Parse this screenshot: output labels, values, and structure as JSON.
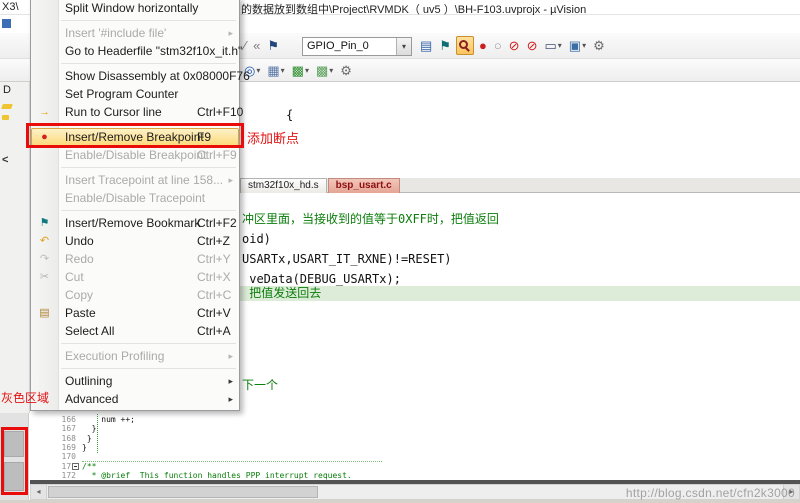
{
  "window": {
    "title_fragment_left": "X3\\",
    "title": "的数据放到数组中\\Project\\RVMDK（ uv5 ）\\BH-F103.uvprojx - µVision"
  },
  "left_pane": {
    "d": "D",
    "chevron": "<"
  },
  "toolbar": {
    "combo_value": "GPIO_Pin_0",
    "row1_pre": [
      {
        "name": "toolbar-fragment-icon-1",
        "glyph": "⁄",
        "color": "#7d7d7d"
      },
      {
        "name": "toolbar-fragment-icon-2",
        "glyph": "«",
        "color": "#7d7d7d"
      },
      {
        "name": "flag-icon",
        "glyph": "⚑",
        "color": "#23467c"
      }
    ],
    "row1_post": [
      {
        "name": "notebook-icon",
        "glyph": "▤",
        "color": "#3465a8"
      },
      {
        "name": "bookmark-flag-icon",
        "glyph": "⚑",
        "color": "#0f6d74"
      },
      {
        "name": "magnifier-breakpoint-icon",
        "glyph": "css-magnifier",
        "color": "#8b2020",
        "boxed": true
      },
      {
        "name": "insert-remove-breakpoint-icon",
        "glyph": "●",
        "color": "#cf1d1d"
      },
      {
        "name": "disable-all-breakpoints-icon",
        "glyph": "○",
        "color": "#9a9a9a"
      },
      {
        "name": "kill-all-breakpoints-icon",
        "glyph": "⊘",
        "color": "#cf1d1d"
      },
      {
        "name": "stop-sign-icon",
        "glyph": "⊘",
        "color": "#cf1d1d"
      },
      {
        "name": "debug-windows-icon",
        "glyph": "▭",
        "color": "#44506e",
        "dropdown": true
      },
      {
        "name": "memory-window-icon",
        "glyph": "▣",
        "color": "#3a6ea5",
        "dropdown": true
      },
      {
        "name": "configure-gear-icon",
        "glyph": "⚙",
        "color": "#6b6b6b"
      }
    ],
    "row2": [
      {
        "name": "target-options-icon",
        "glyph": "◎",
        "color": "#1a56b0",
        "dropdown": true
      },
      {
        "name": "window-layout-icon",
        "glyph": "▦",
        "color": "#5a78a8",
        "dropdown": true
      },
      {
        "name": "build-target-icon",
        "glyph": "▩",
        "color": "#2f8f2f",
        "dropdown": true
      },
      {
        "name": "batch-build-icon",
        "glyph": "▩",
        "color": "#58a058",
        "dropdown": true
      },
      {
        "name": "tools-gear-icon",
        "glyph": "⚙",
        "color": "#6b6b6b"
      }
    ]
  },
  "tabs": [
    {
      "label": "stm32f10x_hd.s",
      "active": false
    },
    {
      "label": "bsp_usart.c",
      "active": true
    }
  ],
  "context_menu": {
    "items": [
      {
        "label": "Split Window horizontally",
        "shortcut": "",
        "enabled": true,
        "submenu": false
      },
      {
        "separator": true
      },
      {
        "label": "Insert '#include file'",
        "shortcut": "",
        "enabled": false,
        "submenu": true
      },
      {
        "label": "Go to Headerfile \"stm32f10x_it.h\"",
        "shortcut": "",
        "enabled": true,
        "submenu": false
      },
      {
        "separator": true
      },
      {
        "label": "Show Disassembly at 0x08000F76",
        "shortcut": "",
        "enabled": true,
        "submenu": false
      },
      {
        "label": "Set Program Counter",
        "shortcut": "",
        "enabled": true,
        "submenu": false
      },
      {
        "label": "Run to Cursor line",
        "shortcut": "Ctrl+F10",
        "enabled": true,
        "submenu": false,
        "icon": "run-to-cursor-icon",
        "icon_glyph": "→",
        "icon_color": "#dfa612"
      },
      {
        "separator": true
      },
      {
        "label": "Insert/Remove Breakpoint",
        "shortcut": "F9",
        "enabled": true,
        "submenu": false,
        "highlighted": true,
        "icon": "breakpoint-dot-icon",
        "icon_glyph": "●",
        "icon_color": "#d42020"
      },
      {
        "label": "Enable/Disable Breakpoint",
        "shortcut": "Ctrl+F9",
        "enabled": false,
        "submenu": false
      },
      {
        "separator": true
      },
      {
        "label": "Insert Tracepoint at line 158...",
        "shortcut": "",
        "enabled": false,
        "submenu": true
      },
      {
        "label": "Enable/Disable Tracepoint",
        "shortcut": "",
        "enabled": false,
        "submenu": false
      },
      {
        "separator": true
      },
      {
        "label": "Insert/Remove Bookmark",
        "shortcut": "Ctrl+F2",
        "enabled": true,
        "submenu": false,
        "icon": "bookmark-flag-icon",
        "icon_glyph": "⚑",
        "icon_color": "#0f7a80"
      },
      {
        "label": "Undo",
        "shortcut": "Ctrl+Z",
        "enabled": true,
        "submenu": false,
        "icon": "undo-arrow-icon",
        "icon_glyph": "↶",
        "icon_color": "#e0a21c"
      },
      {
        "label": "Redo",
        "shortcut": "Ctrl+Y",
        "enabled": false,
        "submenu": false,
        "icon": "redo-arrow-icon",
        "icon_glyph": "↷",
        "icon_color": "#bdbdbd"
      },
      {
        "label": "Cut",
        "shortcut": "Ctrl+X",
        "enabled": false,
        "submenu": false,
        "icon": "cut-scissors-icon",
        "icon_glyph": "✂",
        "icon_color": "#b3b3b3"
      },
      {
        "label": "Copy",
        "shortcut": "Ctrl+C",
        "enabled": false,
        "submenu": false
      },
      {
        "label": "Paste",
        "shortcut": "Ctrl+V",
        "enabled": true,
        "submenu": false,
        "icon": "paste-clipboard-icon",
        "icon_glyph": "▤",
        "icon_color": "#b08433"
      },
      {
        "label": "Select All",
        "shortcut": "Ctrl+A",
        "enabled": true,
        "submenu": false
      },
      {
        "separator": true
      },
      {
        "label": "Execution Profiling",
        "shortcut": "",
        "enabled": false,
        "submenu": true
      },
      {
        "separator": true
      },
      {
        "label": "Outlining",
        "shortcut": "",
        "enabled": true,
        "submenu": true
      },
      {
        "label": "Advanced",
        "shortcut": "",
        "enabled": true,
        "submenu": true
      }
    ]
  },
  "editor_upper": {
    "fragment": "{"
  },
  "editor_top": {
    "lines": [
      {
        "text": "冲区里面，当接收到的值等于0XFF时，把值返回",
        "type": "comment"
      },
      {
        "text": "oid)",
        "type": "code"
      },
      {
        "text": "USARTx,USART_IT_RXNE)!=RESET)",
        "type": "code"
      },
      {
        "text": " veData(DEBUG_USARTx);",
        "type": "code"
      },
      {
        "text": " 把值发送回去",
        "type": "comment",
        "highlight": true
      },
      {
        "text": "下一个",
        "type": "comment"
      }
    ]
  },
  "editor_bottom": {
    "lines": [
      {
        "num": "166",
        "text": "    num ++;",
        "type": "code"
      },
      {
        "num": "167",
        "text": "  }",
        "type": "code"
      },
      {
        "num": "168",
        "text": " }",
        "type": "code"
      },
      {
        "num": "169",
        "text": "}",
        "type": "code"
      },
      {
        "num": "170",
        "text": "",
        "type": "code"
      },
      {
        "num": "171",
        "text": "/**",
        "type": "comment",
        "fold": true
      },
      {
        "num": "172",
        "text": "  * @brief  This function handles PPP interrupt request.",
        "type": "comment"
      }
    ]
  },
  "annotations": {
    "add_breakpoint": "添加断点",
    "gray_area": "灰色区域"
  },
  "watermark": "http://blog.csdn.net/cfn2k3000",
  "colors": {
    "annotation_red": "#e81212",
    "comment_green": "#0a7d0a",
    "menu_highlight": "#fcd977",
    "line_highlight": "#dcecd8"
  }
}
